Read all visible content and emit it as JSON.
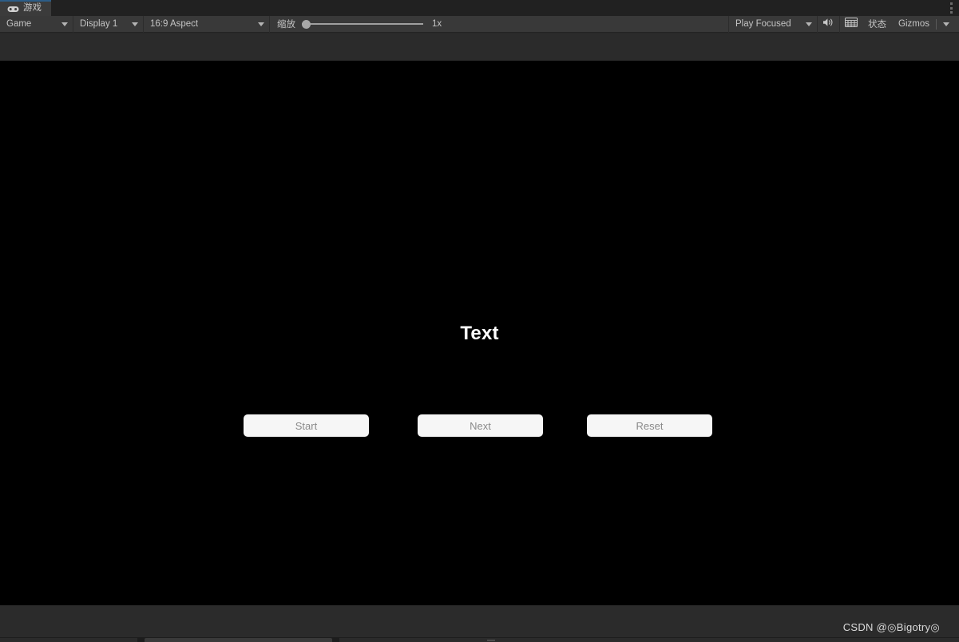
{
  "window": {
    "tab": {
      "label": "游戏",
      "icon": "gamepad-icon"
    },
    "overflow_menu_icon": "kebab-menu-icon"
  },
  "toolbar": {
    "view_mode": {
      "value": "Game",
      "icon": "chevron-down-icon"
    },
    "display": {
      "value": "Display 1",
      "icon": "chevron-down-icon"
    },
    "aspect": {
      "value": "16:9 Aspect",
      "icon": "chevron-down-icon"
    },
    "zoom": {
      "label": "缩放",
      "value": "1x",
      "handle_position_pct": 0
    },
    "play_mode": {
      "value": "Play Focused",
      "icon": "chevron-down-icon"
    },
    "mute_audio": {
      "icon": "speaker-icon"
    },
    "stats_toggle": {
      "icon": "stats-grid-icon",
      "label": "状态"
    },
    "gizmos": {
      "label": "Gizmos",
      "icon": "chevron-down-icon"
    }
  },
  "game": {
    "title_text": "Text",
    "buttons": [
      {
        "name": "start",
        "label": "Start"
      },
      {
        "name": "next",
        "label": "Next"
      },
      {
        "name": "reset",
        "label": "Reset"
      }
    ],
    "background_color": "#000000",
    "button_color": "#f6f6f6",
    "button_text_color": "#8a8a8a"
  },
  "watermark": {
    "text": "CSDN @◎Bigotry◎"
  }
}
